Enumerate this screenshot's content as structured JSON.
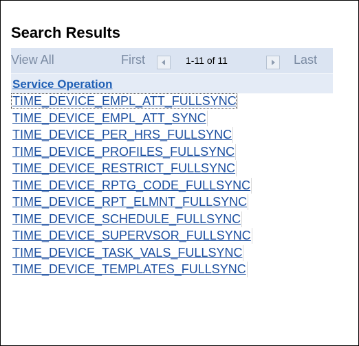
{
  "title": "Search Results",
  "nav": {
    "view_all": "View All",
    "first": "First",
    "count": "1-11 of 11",
    "last": "Last"
  },
  "column_header": "Service Operation",
  "rows": [
    "TIME_DEVICE_EMPL_ATT_FULLSYNC",
    "TIME_DEVICE_EMPL_ATT_SYNC",
    "TIME_DEVICE_PER_HRS_FULLSYNC",
    "TIME_DEVICE_PROFILES_FULLSYNC",
    "TIME_DEVICE_RESTRICT_FULLSYNC",
    "TIME_DEVICE_RPTG_CODE_FULLSYNC",
    "TIME_DEVICE_RPT_ELMNT_FULLSYNC",
    "TIME_DEVICE_SCHEDULE_FULLSYNC",
    "TIME_DEVICE_SUPERVSOR_FULLSYNC",
    "TIME_DEVICE_TASK_VALS_FULLSYNC",
    "TIME_DEVICE_TEMPLATES_FULLSYNC"
  ],
  "colors": {
    "link": "#1c4fa0",
    "nav_bg": "#dbe4f2",
    "header_bg": "#e4ebf6",
    "nav_text": "#7b8ba3"
  },
  "icons": {
    "prev": "arrow-left-icon",
    "next": "arrow-right-icon"
  }
}
